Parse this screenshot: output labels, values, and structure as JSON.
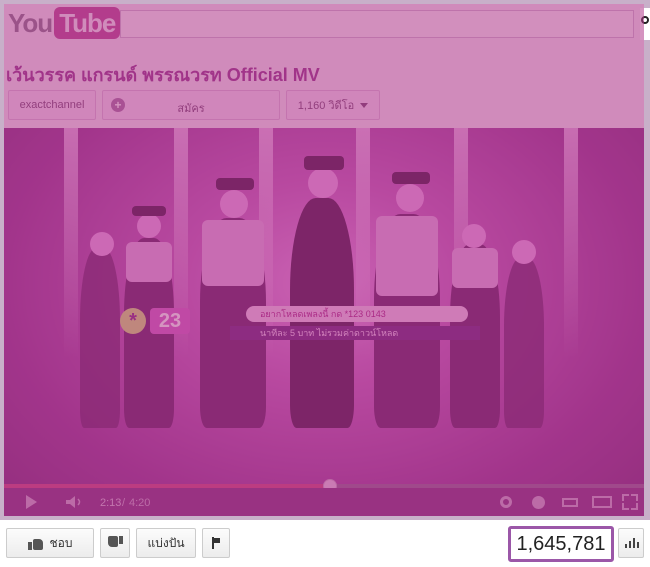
{
  "header": {
    "logo_you": "You",
    "logo_tube": "Tube"
  },
  "video": {
    "title": "เว้นวรรค แกรนด์ พรรณวรท Official MV",
    "banner_top": "อยากโหลดเพลงนี้ กด *123 0143",
    "banner_bottom": "นาทีละ 5 บาท ไม่รวมค่าดาวน์โหลด",
    "badge_number": "23",
    "badge_asterisk": "*"
  },
  "channel": {
    "name": "exactchannel",
    "subscribe_label": "สมัคร",
    "video_count": "1,160 วิดีโอ"
  },
  "player": {
    "time_current": "2:13",
    "time_separator": "/",
    "time_total": "4:20",
    "progress_fraction": 0.51
  },
  "actions": {
    "like_label": "ชอบ",
    "share_label": "แบ่งปัน"
  },
  "stats": {
    "view_count": "1,645,781"
  },
  "colors": {
    "overlay": "#b33c8c",
    "view_box_border": "#9b57a8"
  },
  "icons": [
    "search-icon",
    "plus-icon",
    "caret-down-icon",
    "play-icon",
    "volume-icon",
    "gear-icon",
    "clock-icon",
    "fullscreen-icon",
    "thumbs-up-icon",
    "thumbs-down-icon",
    "flag-icon",
    "stats-icon"
  ]
}
